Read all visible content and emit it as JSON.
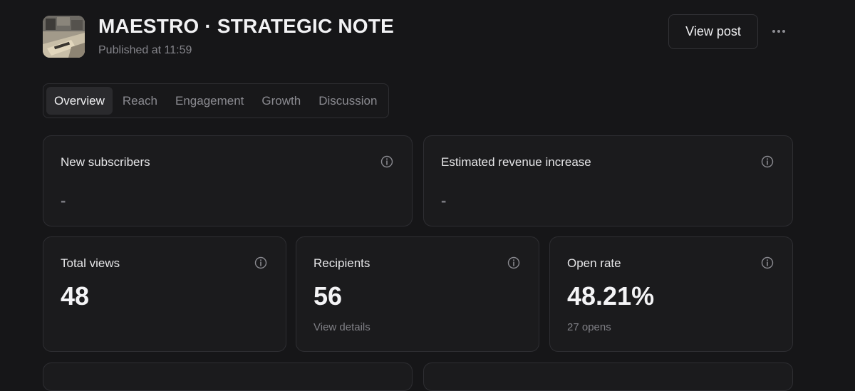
{
  "post": {
    "title": "MAESTRO · STRATEGIC NOTE",
    "published": "Published at 11:59",
    "thumbnail_icon": "post-thumbnail-image"
  },
  "actions": {
    "view_post": "View post",
    "more_icon": "more-horizontal-icon"
  },
  "tabs": [
    {
      "label": "Overview",
      "active": true
    },
    {
      "label": "Reach",
      "active": false
    },
    {
      "label": "Engagement",
      "active": false
    },
    {
      "label": "Growth",
      "active": false
    },
    {
      "label": "Discussion",
      "active": false
    }
  ],
  "stats_top": [
    {
      "label": "New subscribers",
      "value": "-"
    },
    {
      "label": "Estimated revenue increase",
      "value": "-"
    }
  ],
  "stats_main": [
    {
      "label": "Total views",
      "value": "48",
      "sub": ""
    },
    {
      "label": "Recipients",
      "value": "56",
      "sub": "View details"
    },
    {
      "label": "Open rate",
      "value": "48.21%",
      "sub": "27 opens"
    }
  ],
  "colors": {
    "background": "#161618",
    "card": "#1b1b1d",
    "border": "#2e2e32",
    "text_primary": "#f2f2f4",
    "text_muted": "#85858b"
  }
}
